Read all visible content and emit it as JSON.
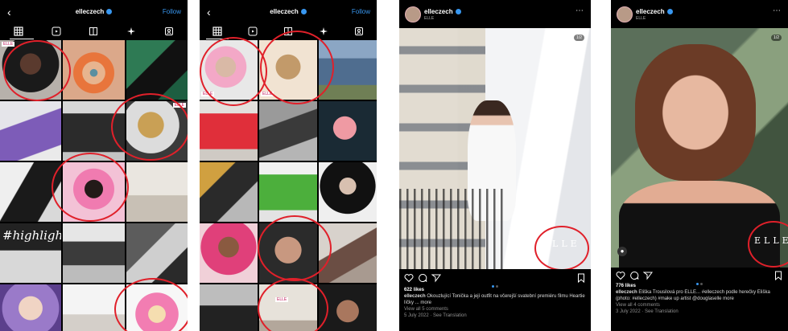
{
  "profile_grid_1": {
    "username": "elleczech",
    "follow_label": "Follow",
    "highlights_text": "#highlights"
  },
  "profile_grid_2": {
    "username": "elleczech",
    "follow_label": "Follow"
  },
  "post_1": {
    "username": "elleczech",
    "subtitle": "ELLE",
    "likes": "622 likes",
    "caption_user": "elleczech",
    "caption_text": "Okouzlující Tonička a její outfit na včerejší svatební premiéru filmu Heartie líčky ... more",
    "view_comments": "View all 5 comments",
    "date": "5 July 2022 · See Translation",
    "logo": "ELLE"
  },
  "post_2": {
    "username": "elleczech",
    "subtitle": "ELLE",
    "likes": "776 likes",
    "caption_user": "elleczech",
    "caption_text": "Eliška Trousilová pro ELLE... #elleczech podle herečky Eliška (photo: #elleczech) #make up artist @douglaselle more",
    "view_comments": "View all 4 comments",
    "date": "3 July 2022 · See Translation",
    "logo": "ELLE"
  },
  "colors": {
    "accent_blue": "#3897f0",
    "annotation_red": "#e0202a",
    "panel_bg": "#000000"
  }
}
